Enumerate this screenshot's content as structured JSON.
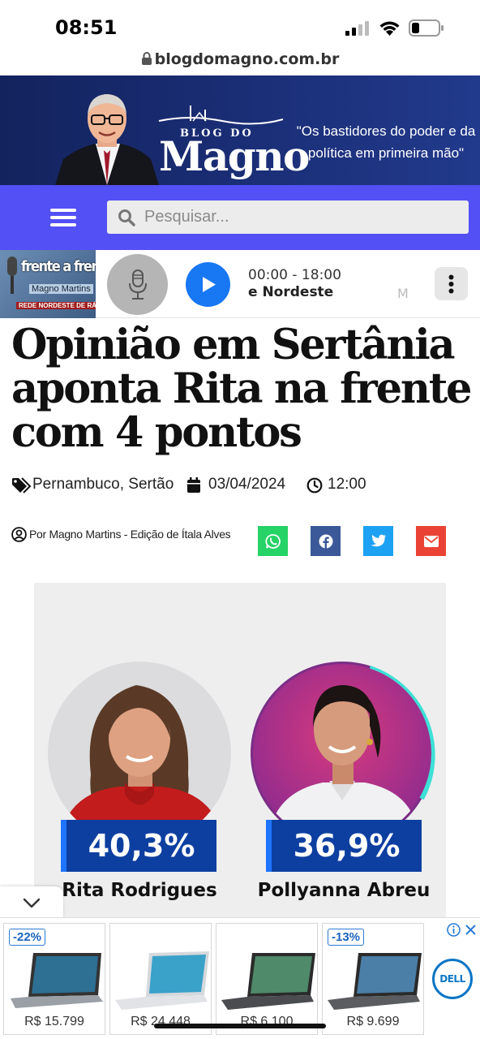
{
  "status_bar": {
    "time": "08:51",
    "url": "blogdomagno.com.br"
  },
  "header": {
    "logo_top": "BLOG DO",
    "logo_main": "Magno",
    "tagline_line1": "\"Os bastidores do poder e da",
    "tagline_line2": "política em primeira mão\""
  },
  "search": {
    "placeholder": "Pesquisar..."
  },
  "player": {
    "station_line1": "frente a frente",
    "station_line2": "Magno Martins",
    "station_line3": "REDE NORDESTE DE RÁDIO",
    "schedule": "00:00 - 18:00",
    "program": "e Nordeste",
    "marquee_next": "M"
  },
  "article": {
    "title": "Opinião em Sertânia aponta Rita na frente com 4 pontos",
    "categories": "Pernambuco, Sertão",
    "date": "03/04/2024",
    "time": "12:00",
    "byline": "Por Magno Martins - Edição de Ítala Alves"
  },
  "share": {
    "whatsapp": "whatsapp-share",
    "facebook": "facebook-share",
    "twitter": "twitter-share",
    "email": "email-share",
    "colors": {
      "whatsapp": "#25d366",
      "facebook": "#3b5998",
      "twitter": "#1da1f2",
      "email": "#ea4335"
    }
  },
  "poll": {
    "candidates": [
      {
        "name": "Rita Rodrigues",
        "percent": "40,3%"
      },
      {
        "name": "Pollyanna Abreu",
        "percent": "36,9%"
      }
    ]
  },
  "ad": {
    "products": [
      {
        "discount": "-22%",
        "price": "R$ 15.799"
      },
      {
        "discount": "",
        "price": "R$ 24.448"
      },
      {
        "discount": "",
        "price": "R$ 6.100"
      },
      {
        "discount": "-13%",
        "price": "R$ 9.699"
      }
    ],
    "brand": "DELL"
  },
  "colors": {
    "nav_purple": "#5350f5",
    "header_navy": "#1b2f78",
    "play_blue": "#1877f2",
    "poll_blue": "#0d3fa1"
  }
}
